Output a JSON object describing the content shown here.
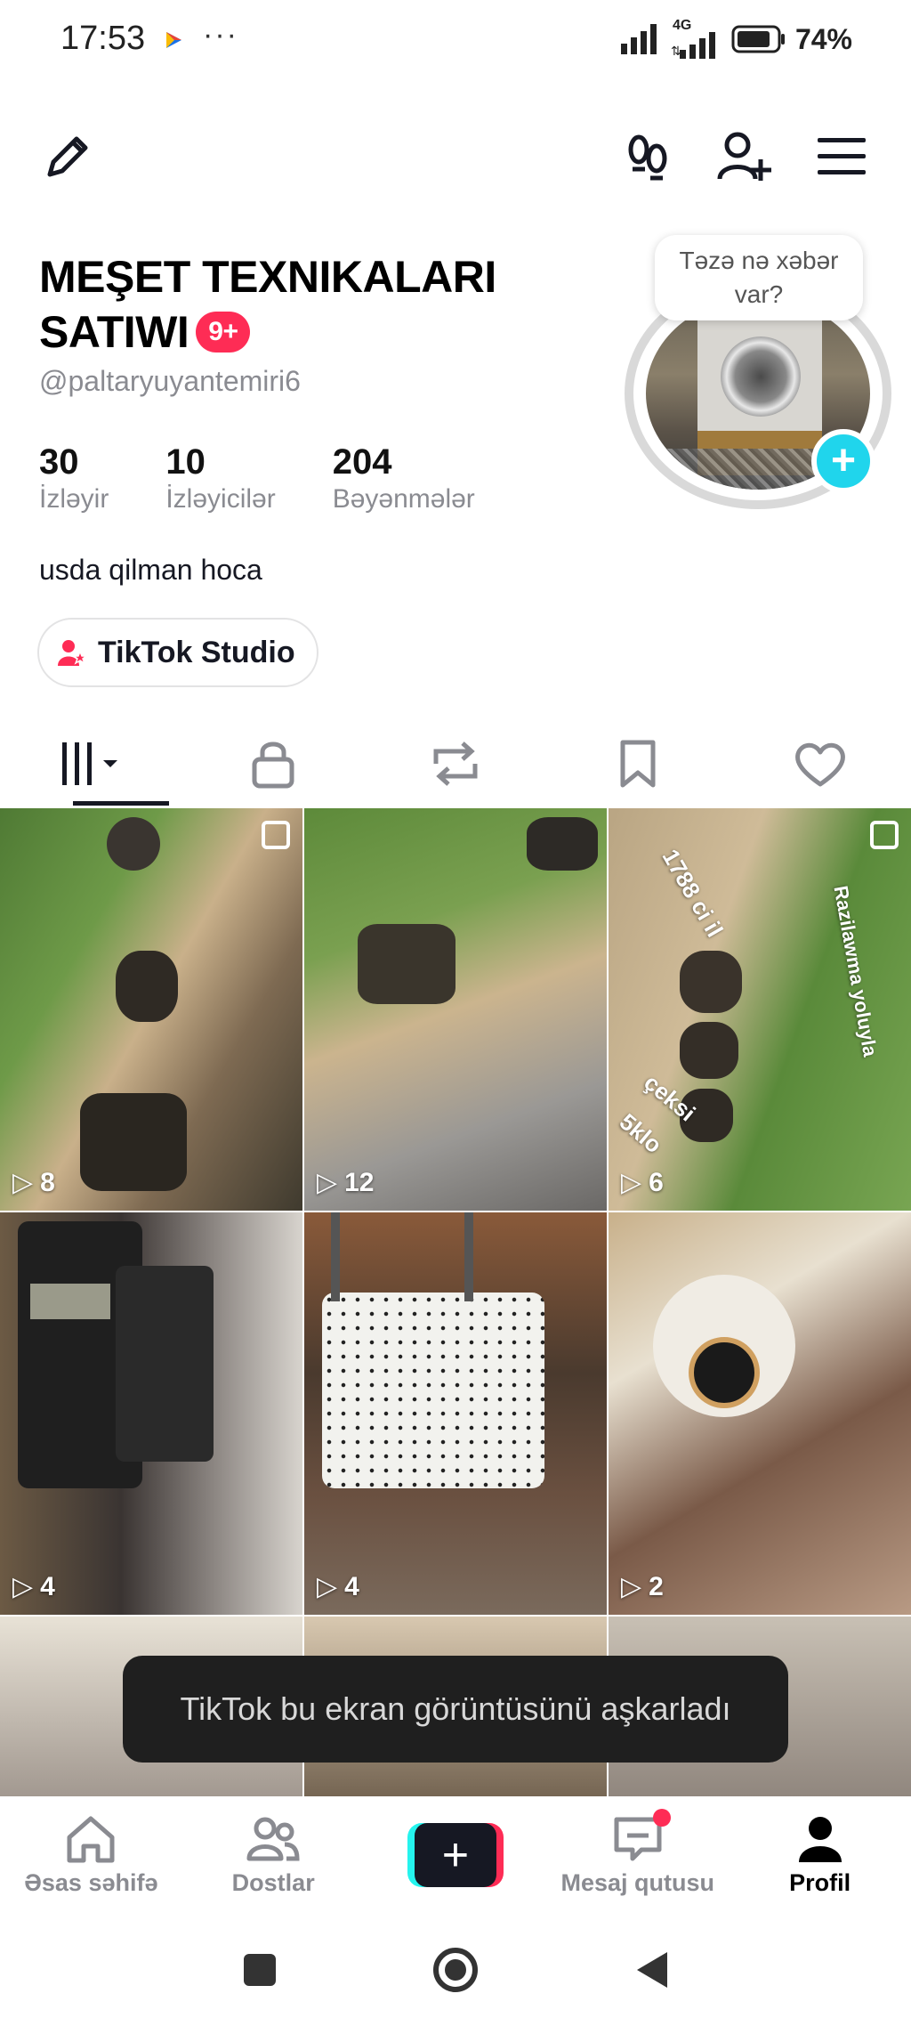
{
  "status_bar": {
    "time": "17:53",
    "dots": "···",
    "network": "4G",
    "battery": "74%"
  },
  "topbar": {
    "icons": [
      "edit-icon",
      "footprints-icon",
      "add-friend-icon",
      "menu-icon"
    ]
  },
  "profile": {
    "display_name": "MEŞET TEXNIKALARI SATIWI",
    "badge": "9+",
    "handle": "@paltaryuyantemiri6",
    "stats": [
      {
        "value": "30",
        "label": "İzləyir"
      },
      {
        "value": "10",
        "label": "İzləyicilər"
      },
      {
        "value": "204",
        "label": "Bəyənmələr"
      }
    ],
    "bio": "usda qilman hoca",
    "studio_button": "TikTok Studio",
    "story_prompt": "Təzə nə xəbər var?",
    "avatar_add": "+"
  },
  "tabs": [
    "videos",
    "private",
    "reposts",
    "favorites",
    "liked"
  ],
  "grid": {
    "tiles": [
      {
        "count": "8",
        "multi": true,
        "overlay": []
      },
      {
        "count": "12",
        "multi": false,
        "overlay": []
      },
      {
        "count": "6",
        "multi": true,
        "overlay": [
          "1788 ci il",
          "Razilawma yoluyla",
          "çeksi",
          "5klo"
        ]
      },
      {
        "count": "4",
        "multi": false,
        "overlay": []
      },
      {
        "count": "4",
        "multi": false,
        "overlay": []
      },
      {
        "count": "2",
        "multi": false,
        "overlay": []
      },
      {
        "count": "",
        "multi": false,
        "overlay": []
      },
      {
        "count": "",
        "multi": false,
        "overlay": []
      },
      {
        "count": "",
        "multi": false,
        "overlay": []
      }
    ]
  },
  "toast": "TikTok bu ekran görüntüsünü aşkarladı",
  "bottom_nav": {
    "home": "Əsas səhifə",
    "friends": "Dostlar",
    "create": "+",
    "inbox": "Mesaj qutusu",
    "profile": "Profil"
  },
  "colors": {
    "accent": "#fe2c55",
    "cyan": "#25f4ee",
    "text": "#161823",
    "muted": "#8a8b91"
  }
}
